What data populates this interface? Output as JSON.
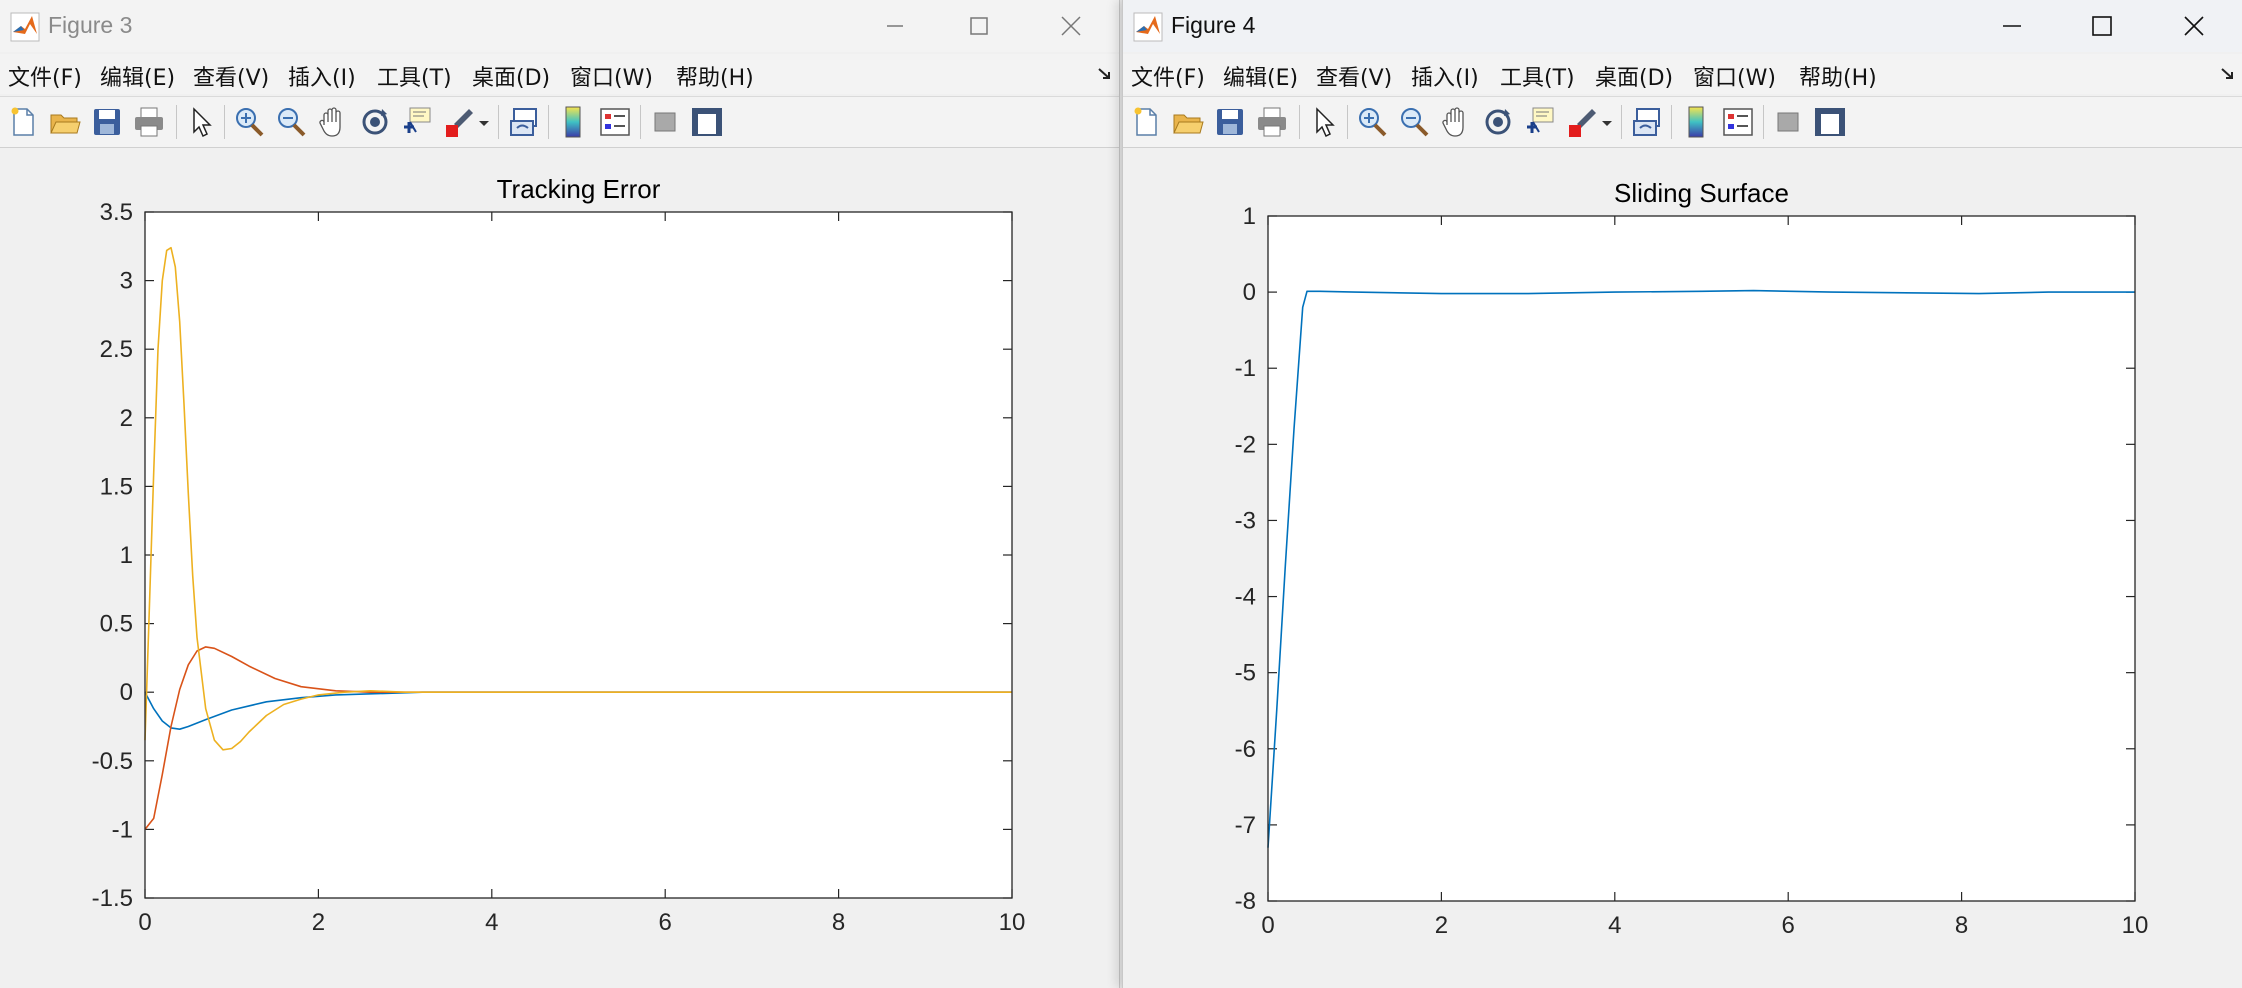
{
  "figure3": {
    "window_title": "Figure 3",
    "menu": [
      "文件(F)",
      "编辑(E)",
      "查看(V)",
      "插入(I)",
      "工具(T)",
      "桌面(D)",
      "窗口(W)",
      "帮助(H)"
    ]
  },
  "figure4": {
    "window_title": "Figure 4",
    "menu": [
      "文件(F)",
      "编辑(E)",
      "查看(V)",
      "插入(I)",
      "工具(T)",
      "桌面(D)",
      "窗口(W)",
      "帮助(H)"
    ]
  },
  "toolbar_icons": [
    "new-figure-icon",
    "open-file-icon",
    "save-icon",
    "print-icon",
    "edit-plot-arrow-icon",
    "zoom-in-icon",
    "zoom-out-icon",
    "pan-hand-icon",
    "rotate-3d-icon",
    "data-cursor-icon",
    "brush-icon",
    "brush-dropdown-icon",
    "link-plot-icon",
    "insert-colorbar-icon",
    "insert-legend-icon",
    "hide-plot-tools-icon",
    "show-plot-tools-icon"
  ],
  "colors": {
    "blue": "#0072BD",
    "orange": "#D95319",
    "yellow": "#EDB120"
  },
  "chart_data": [
    {
      "type": "line",
      "title": "Tracking Error",
      "xlabel": "",
      "ylabel": "",
      "xlim": [
        0,
        10
      ],
      "ylim": [
        -1.5,
        3.5
      ],
      "xticks": [
        0,
        2,
        4,
        6,
        8,
        10
      ],
      "yticks": [
        3.5,
        3,
        2.5,
        2,
        1.5,
        1,
        0.5,
        0,
        -0.5,
        -1,
        -1.5
      ],
      "grid": false,
      "series": [
        {
          "color": "#0072BD",
          "x": [
            0,
            0.1,
            0.2,
            0.3,
            0.4,
            0.5,
            0.7,
            1.0,
            1.4,
            1.8,
            2.2,
            2.7,
            3.2,
            4,
            6,
            8,
            10
          ],
          "y": [
            0,
            -0.12,
            -0.21,
            -0.26,
            -0.27,
            -0.25,
            -0.2,
            -0.13,
            -0.07,
            -0.04,
            -0.02,
            -0.01,
            0,
            0,
            0,
            0,
            0
          ]
        },
        {
          "color": "#D95319",
          "x": [
            0,
            0.1,
            0.2,
            0.3,
            0.4,
            0.5,
            0.6,
            0.7,
            0.8,
            1.0,
            1.2,
            1.5,
            1.8,
            2.2,
            2.6,
            3.0,
            4,
            6,
            8,
            10
          ],
          "y": [
            -1,
            -0.92,
            -0.6,
            -0.25,
            0.02,
            0.2,
            0.3,
            0.33,
            0.32,
            0.26,
            0.19,
            0.1,
            0.04,
            0.01,
            0,
            0,
            0,
            0,
            0,
            0
          ]
        },
        {
          "color": "#EDB120",
          "x": [
            0,
            0.05,
            0.1,
            0.15,
            0.2,
            0.25,
            0.3,
            0.35,
            0.4,
            0.45,
            0.5,
            0.55,
            0.6,
            0.7,
            0.8,
            0.9,
            1.0,
            1.1,
            1.2,
            1.4,
            1.6,
            1.8,
            2.0,
            2.3,
            2.6,
            3.0,
            4,
            6,
            8,
            10
          ],
          "y": [
            -0.35,
            0.6,
            1.6,
            2.5,
            3.0,
            3.22,
            3.24,
            3.1,
            2.7,
            2.1,
            1.45,
            0.85,
            0.4,
            -0.12,
            -0.35,
            -0.42,
            -0.41,
            -0.36,
            -0.29,
            -0.17,
            -0.09,
            -0.05,
            -0.02,
            0,
            0.01,
            0,
            0,
            0,
            0,
            0
          ]
        }
      ]
    },
    {
      "type": "line",
      "title": "Sliding Surface",
      "xlabel": "",
      "ylabel": "",
      "xlim": [
        0,
        10
      ],
      "ylim": [
        -8,
        1
      ],
      "xticks": [
        0,
        2,
        4,
        6,
        8,
        10
      ],
      "yticks": [
        1,
        0,
        -1,
        -2,
        -3,
        -4,
        -5,
        -6,
        -7,
        -8
      ],
      "grid": false,
      "series": [
        {
          "color": "#0072BD",
          "x": [
            0,
            0.1,
            0.2,
            0.3,
            0.4,
            0.45,
            0.6,
            1.0,
            2.0,
            3.0,
            4.0,
            5.0,
            5.6,
            6.5,
            7.5,
            8.2,
            9.0,
            10
          ],
          "y": [
            -7.3,
            -5.5,
            -3.6,
            -1.8,
            -0.2,
            0.01,
            0.01,
            0,
            -0.02,
            -0.02,
            0,
            0.01,
            0.02,
            0,
            -0.01,
            -0.02,
            0,
            0
          ]
        }
      ]
    }
  ]
}
